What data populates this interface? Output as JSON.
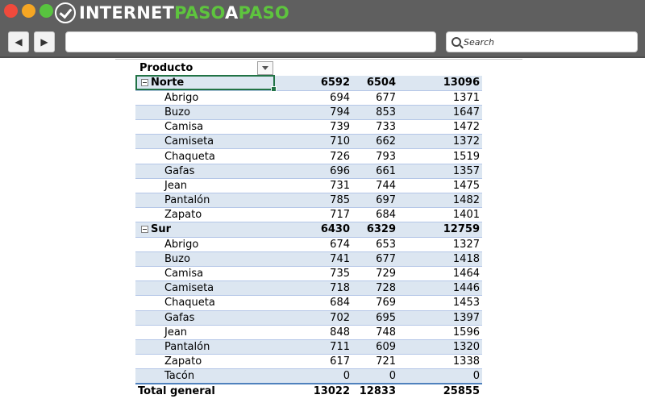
{
  "logo": {
    "part1": "INTERNET",
    "part2": "PASO",
    "part3": "A",
    "part4": "PASO"
  },
  "search": {
    "placeholder": "Search"
  },
  "colors": {
    "accent": "#5ec43e",
    "chrome": "#5f5f5f",
    "row_shade": "#dce6f1",
    "selection": "#217346"
  },
  "pivot": {
    "header": "Producto",
    "groups": [
      {
        "name": "Norte",
        "v1": "6592",
        "v2": "6504",
        "v3": "13096",
        "items": [
          {
            "name": "Abrigo",
            "v1": "694",
            "v2": "677",
            "v3": "1371"
          },
          {
            "name": "Buzo",
            "v1": "794",
            "v2": "853",
            "v3": "1647"
          },
          {
            "name": "Camisa",
            "v1": "739",
            "v2": "733",
            "v3": "1472"
          },
          {
            "name": "Camiseta",
            "v1": "710",
            "v2": "662",
            "v3": "1372"
          },
          {
            "name": "Chaqueta",
            "v1": "726",
            "v2": "793",
            "v3": "1519"
          },
          {
            "name": "Gafas",
            "v1": "696",
            "v2": "661",
            "v3": "1357"
          },
          {
            "name": "Jean",
            "v1": "731",
            "v2": "744",
            "v3": "1475"
          },
          {
            "name": "Pantalón",
            "v1": "785",
            "v2": "697",
            "v3": "1482"
          },
          {
            "name": "Zapato",
            "v1": "717",
            "v2": "684",
            "v3": "1401"
          }
        ]
      },
      {
        "name": "Sur",
        "v1": "6430",
        "v2": "6329",
        "v3": "12759",
        "items": [
          {
            "name": "Abrigo",
            "v1": "674",
            "v2": "653",
            "v3": "1327"
          },
          {
            "name": "Buzo",
            "v1": "741",
            "v2": "677",
            "v3": "1418"
          },
          {
            "name": "Camisa",
            "v1": "735",
            "v2": "729",
            "v3": "1464"
          },
          {
            "name": "Camiseta",
            "v1": "718",
            "v2": "728",
            "v3": "1446"
          },
          {
            "name": "Chaqueta",
            "v1": "684",
            "v2": "769",
            "v3": "1453"
          },
          {
            "name": "Gafas",
            "v1": "702",
            "v2": "695",
            "v3": "1397"
          },
          {
            "name": "Jean",
            "v1": "848",
            "v2": "748",
            "v3": "1596"
          },
          {
            "name": "Pantalón",
            "v1": "711",
            "v2": "609",
            "v3": "1320"
          },
          {
            "name": "Zapato",
            "v1": "617",
            "v2": "721",
            "v3": "1338"
          },
          {
            "name": "Tacón",
            "v1": "0",
            "v2": "0",
            "v3": "0"
          }
        ]
      }
    ],
    "total": {
      "name": "Total general",
      "v1": "13022",
      "v2": "12833",
      "v3": "25855"
    }
  }
}
